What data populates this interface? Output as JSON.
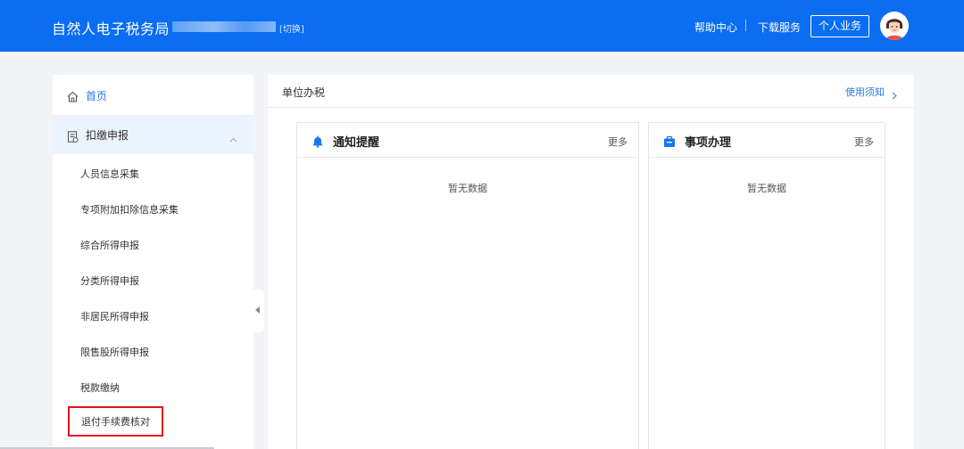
{
  "header": {
    "app_title": "自然人电子税务局",
    "switch_label": "[切换]",
    "help_label": "帮助中心",
    "download_label": "下载服务",
    "personal_label": "个人业务",
    "brand_color": "#0a6df2"
  },
  "sidebar": {
    "home_label": "首页",
    "declare_label": "扣缴申报",
    "sub_items": [
      "人员信息采集",
      "专项附加扣除信息采集",
      "综合所得申报",
      "分类所得申报",
      "非居民所得申报",
      "限售股所得申报",
      "税款缴纳",
      "退付手续费核对"
    ],
    "highlighted_item": "退付手续费核对",
    "active_bg": "#eaf3fe"
  },
  "main": {
    "title": "单位办税",
    "usage_label": "使用须知",
    "cards": [
      {
        "title": "通知提醒",
        "more_label": "更多",
        "empty_text": "暂无数据",
        "icon": "bell-icon"
      },
      {
        "title": "事项办理",
        "more_label": "更多",
        "empty_text": "暂无数据",
        "icon": "briefcase-icon"
      }
    ]
  }
}
